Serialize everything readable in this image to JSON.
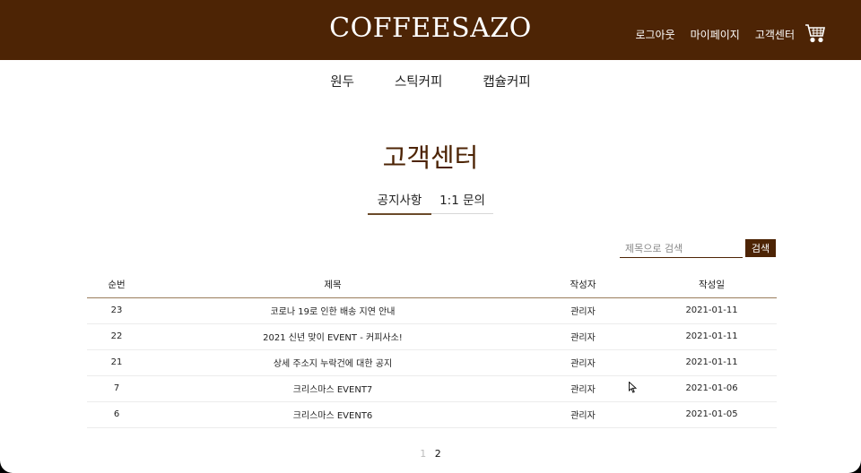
{
  "header": {
    "logo": "COFFEESAZO",
    "links": [
      "로그아웃",
      "마이페이지",
      "고객센터"
    ],
    "cart_icon": "cart-icon",
    "background": "#4d2405"
  },
  "category_nav": [
    "원두",
    "스틱커피",
    "캡슐커피"
  ],
  "page_title": "고객센터",
  "tabs": [
    "공지사항",
    "1:1 문의"
  ],
  "search": {
    "placeholder": "제목으로 검색",
    "button": "검색"
  },
  "table": {
    "headers": [
      "순번",
      "제목",
      "작성자",
      "작성일"
    ],
    "rows": [
      [
        "23",
        "코로나 19로 인한 배송 지연 안내",
        "관리자",
        "2021-01-11"
      ],
      [
        "22",
        "2021 신년 맞이 EVENT - 커피사소!",
        "관리자",
        "2021-01-11"
      ],
      [
        "21",
        "상세 주소지 누락건에 대한 공지",
        "관리자",
        "2021-01-11"
      ],
      [
        "7",
        "크리스마스 EVENT7",
        "관리자",
        "2021-01-06"
      ],
      [
        "6",
        "크리스마스 EVENT6",
        "관리자",
        "2021-01-05"
      ]
    ]
  },
  "pagination": {
    "pages": [
      "1",
      "2"
    ],
    "current": "2"
  }
}
